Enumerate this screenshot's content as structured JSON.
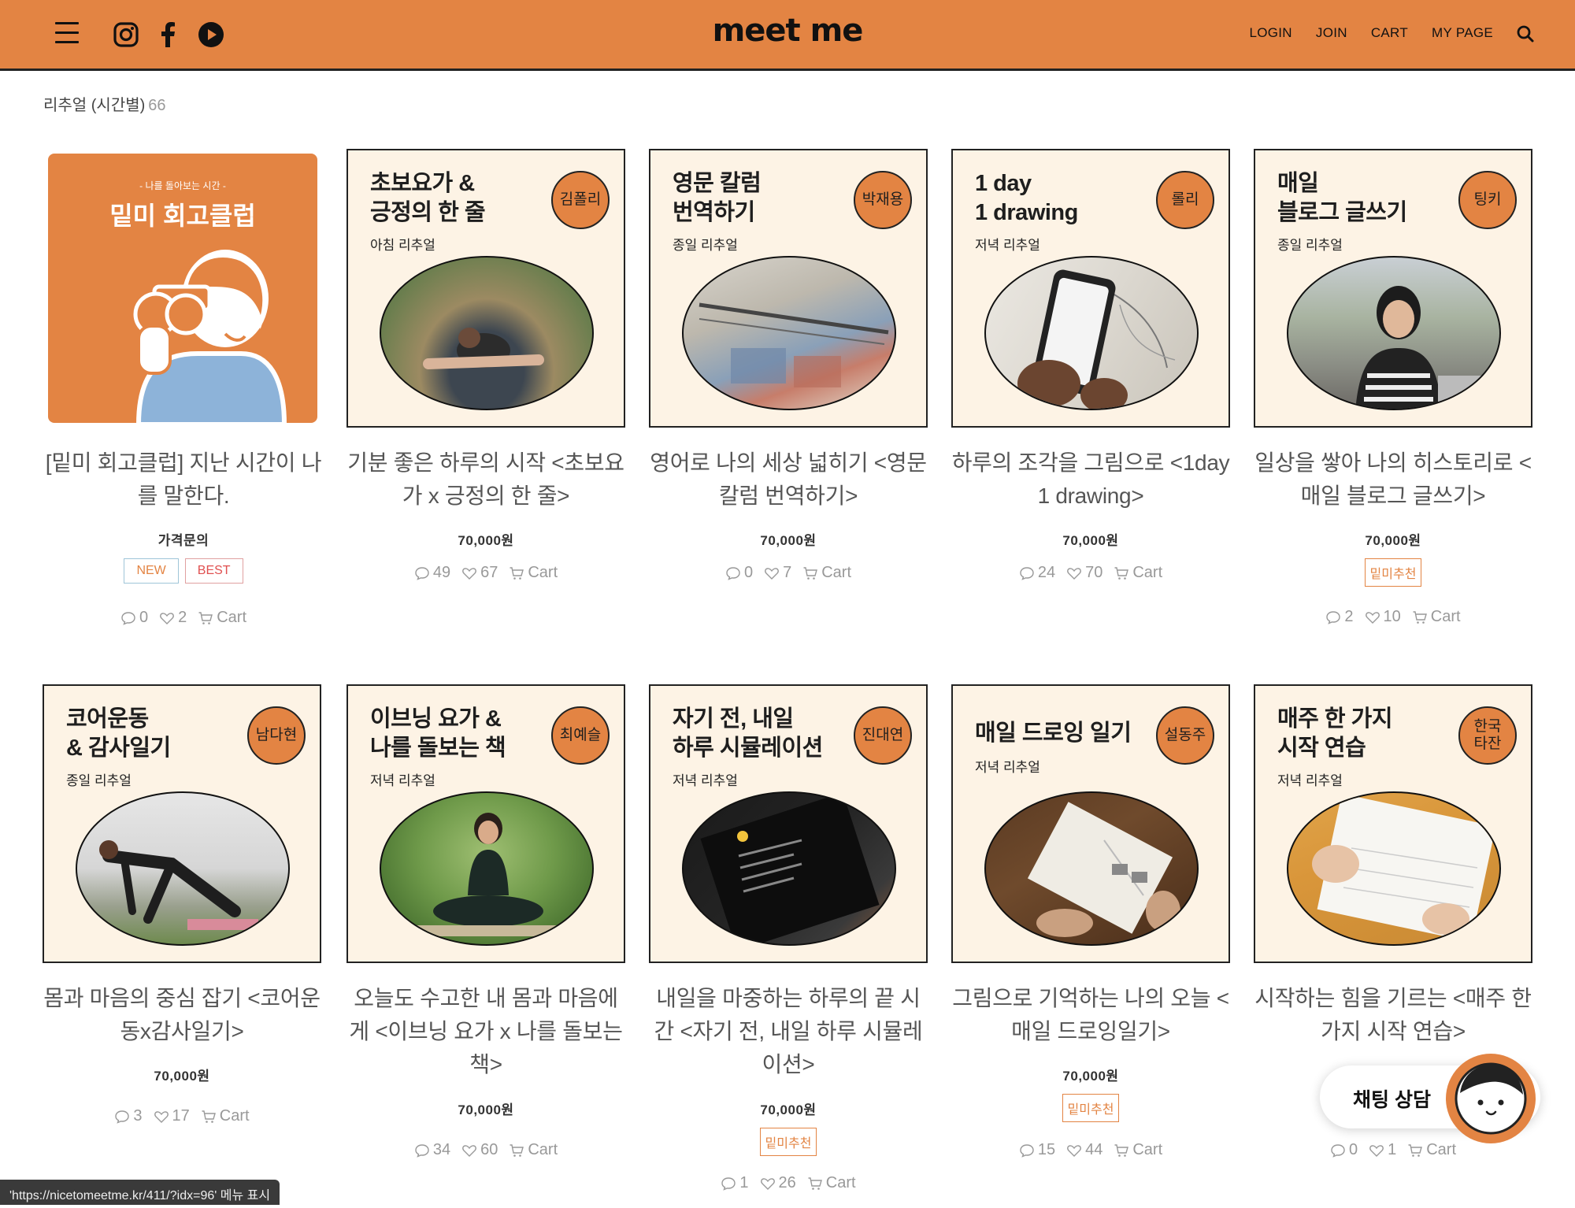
{
  "header": {
    "logo": "meet me",
    "nav": [
      "LOGIN",
      "JOIN",
      "CART",
      "MY PAGE"
    ],
    "accent": "#e38443"
  },
  "breadcrumb": {
    "category": "리추얼 (시간별)",
    "count": "66"
  },
  "products": [
    {
      "thumb_title": "",
      "thumb_sub": "",
      "badge": "",
      "poster": {
        "kicker": "- 나를 돌아보는 시간 -",
        "title": "밑미 회고클럽"
      },
      "name": "[밑미 회고클럽] 지난 시간이 나를 말한다.",
      "price": "가격문의",
      "tags": [
        "NEW",
        "BEST"
      ],
      "comments": "0",
      "likes": "2",
      "cart": "Cart"
    },
    {
      "thumb_title": "초보요가 &\n긍정의 한 줄",
      "thumb_sub": "아침 리추얼",
      "badge": "김폴리",
      "name": "기분 좋은 하루의 시작 <초보요가 x 긍정의 한 줄>",
      "price": "70,000원",
      "tags": [],
      "comments": "49",
      "likes": "67",
      "cart": "Cart"
    },
    {
      "thumb_title": "영문 칼럼\n번역하기",
      "thumb_sub": "종일 리추얼",
      "badge": "박재용",
      "name": "영어로 나의 세상 넓히기 <영문 칼럼 번역하기>",
      "price": "70,000원",
      "tags": [],
      "comments": "0",
      "likes": "7",
      "cart": "Cart"
    },
    {
      "thumb_title": "1 day\n1 drawing",
      "thumb_sub": "저녁 리추얼",
      "badge": "롤리",
      "name": "하루의 조각을 그림으로 <1day 1 drawing>",
      "price": "70,000원",
      "tags": [],
      "comments": "24",
      "likes": "70",
      "cart": "Cart"
    },
    {
      "thumb_title": "매일\n블로그 글쓰기",
      "thumb_sub": "종일 리추얼",
      "badge": "팅키",
      "name": "일상을 쌓아 나의 히스토리로 <매일 블로그 글쓰기>",
      "price": "70,000원",
      "tags": [
        "밑미추천"
      ],
      "comments": "2",
      "likes": "10",
      "cart": "Cart"
    },
    {
      "thumb_title": "코어운동\n& 감사일기",
      "thumb_sub": "종일 리추얼",
      "badge": "남다현",
      "name": "몸과 마음의 중심 잡기 <코어운동x감사일기>",
      "price": "70,000원",
      "tags": [],
      "comments": "3",
      "likes": "17",
      "cart": "Cart"
    },
    {
      "thumb_title": "이브닝 요가 &\n나를 돌보는 책",
      "thumb_sub": "저녁 리추얼",
      "badge": "최예슬",
      "name": "오늘도 수고한 내 몸과 마음에게 <이브닝 요가 x 나를 돌보는 책>",
      "price": "70,000원",
      "tags": [],
      "comments": "34",
      "likes": "60",
      "cart": "Cart"
    },
    {
      "thumb_title": "자기 전, 내일\n하루 시뮬레이션",
      "thumb_sub": "저녁 리추얼",
      "badge": "진대연",
      "name": "내일을 마중하는 하루의 끝 시간 <자기 전, 내일 하루 시뮬레이션>",
      "price": "70,000원",
      "tags": [
        "밑미추천"
      ],
      "comments": "1",
      "likes": "26",
      "cart": "Cart"
    },
    {
      "thumb_title": "매일 드로잉 일기",
      "thumb_sub": "저녁 리추얼",
      "badge": "설동주",
      "name": "그림으로 기억하는 나의 오늘 <매일 드로잉일기>",
      "price": "70,000원",
      "tags": [
        "밑미추천"
      ],
      "comments": "15",
      "likes": "44",
      "cart": "Cart"
    },
    {
      "thumb_title": "매주 한 가지\n시작 연습",
      "thumb_sub": "저녁 리추얼",
      "badge": "한국\n타잔",
      "name": "시작하는 힘을 기르는 <매주 한 가지 시작 연습>",
      "price": "",
      "tags": [],
      "comments": "0",
      "likes": "1",
      "cart": "Cart"
    }
  ],
  "chat": {
    "label": "채팅 상담"
  },
  "status": {
    "url": "'https://nicetomeetme.kr/411/?idx=96' 메뉴 표시"
  }
}
